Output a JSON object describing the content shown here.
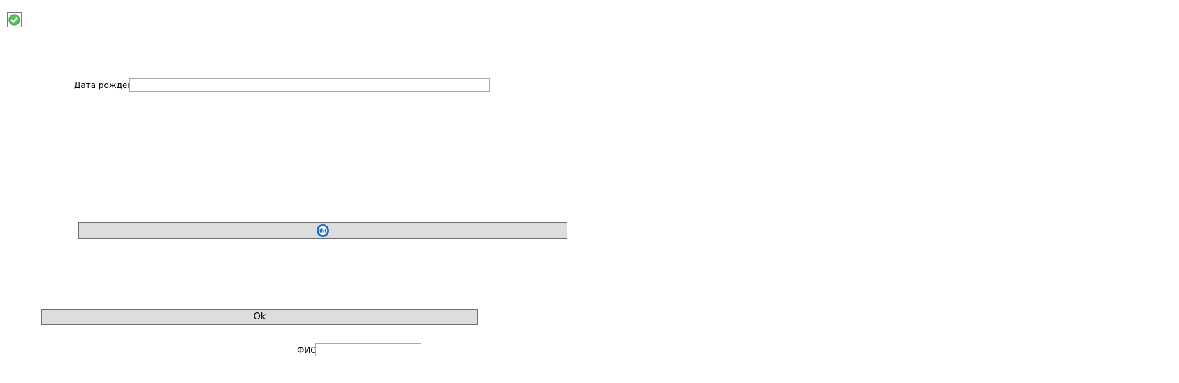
{
  "status_checkbox": {
    "icon": "check-circle-icon",
    "color": "#4caf50"
  },
  "birth_date": {
    "label": "Дата рождения",
    "value": "",
    "placeholder": ""
  },
  "refresh_button": {
    "icon": "refresh-icon",
    "color": "#1f6fc5"
  },
  "ok_button": {
    "label": "Ok"
  },
  "full_name": {
    "label": "ФИО",
    "value": "",
    "placeholder": ""
  }
}
